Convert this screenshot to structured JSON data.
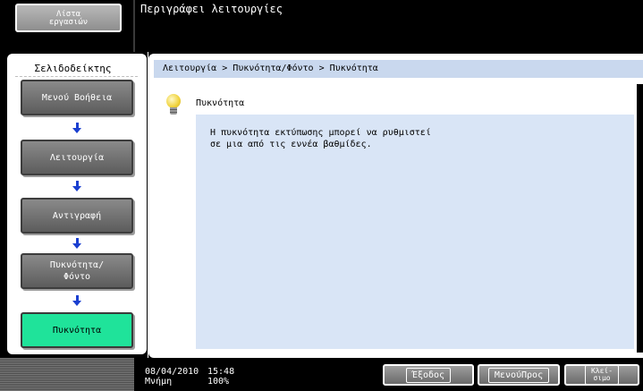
{
  "top_bar": {
    "list_button": {
      "line1": "Λίστα",
      "line2": "εργασιών"
    },
    "title": "Περιγράφει λειτουργίες"
  },
  "sidebar": {
    "title": "Σελιδοδείκτης",
    "items": [
      {
        "label": "Μενού Βοήθεια",
        "active": false
      },
      {
        "label": "Λειτουργία",
        "active": false
      },
      {
        "label": "Αντιγραφή",
        "active": false
      },
      {
        "label": "Πυκνότητα/\nΦόντο",
        "active": false
      },
      {
        "label": "Πυκνότητα",
        "active": true
      }
    ]
  },
  "main": {
    "breadcrumb": "Λειτουργία > Πυκνότητα/Φόντο > Πυκνότητα",
    "heading": "Πυκνότητα",
    "description": "Η πυκνότητα εκτύπωσης μπορεί να ρυθμιστεί\nσε μια από τις εννέα βαθμίδες."
  },
  "status_bar": {
    "date": "08/04/2010",
    "memory_label": "Μνήμη",
    "time": "15:48",
    "memory_value": "100%",
    "exit_label": "Έξοδος",
    "menu_label": "ΜενούΠρος",
    "close_line1": "Κλεί-",
    "close_line2": "σιμο"
  },
  "colors": {
    "active_item": "#1fe39a",
    "breadcrumb_bg": "#c9d8ee",
    "content_bg": "#d9e5f6",
    "arrow": "#1a3fd0"
  }
}
